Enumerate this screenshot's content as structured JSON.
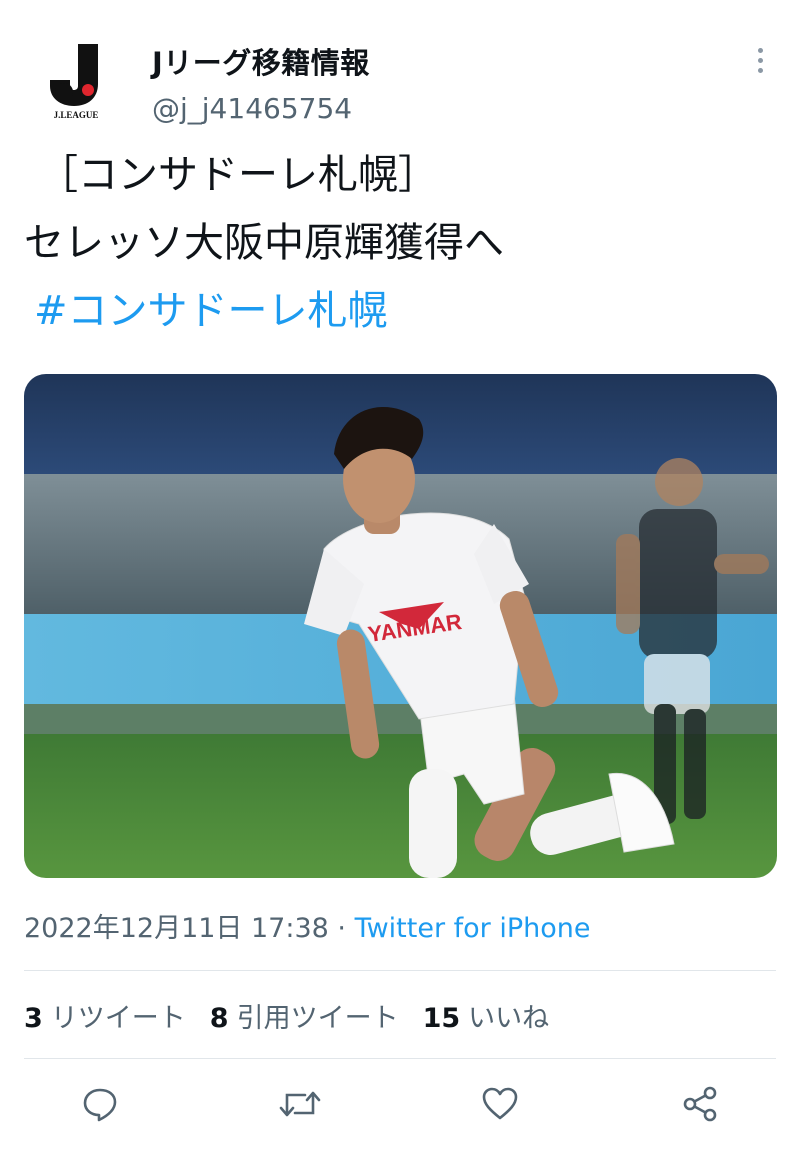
{
  "user": {
    "display_name": "Jリーグ移籍情報",
    "handle": "@j_j41465754",
    "avatar_text": "J.LEAGUE"
  },
  "tweet": {
    "line1": "［コンサドーレ札幌］",
    "line2": "セレッソ大阪中原輝獲得へ",
    "hashtag": "#コンサドーレ札幌"
  },
  "photo": {
    "jersey_sponsor": "YANMAR"
  },
  "meta": {
    "timestamp": "2022年12月11日 17:38",
    "separator": " · ",
    "source": "Twitter for iPhone"
  },
  "stats": {
    "retweets_count": "3",
    "retweets_label": "リツイート",
    "quotes_count": "8",
    "quotes_label": "引用ツイート",
    "likes_count": "15",
    "likes_label": "いいね"
  },
  "icons": {
    "reply": "reply-icon",
    "retweet": "retweet-icon",
    "like": "like-icon",
    "share": "share-icon",
    "more": "more-vertical-icon"
  },
  "colors": {
    "link": "#1d9bf0",
    "secondary_text": "#536471",
    "primary_text": "#0f1419"
  }
}
